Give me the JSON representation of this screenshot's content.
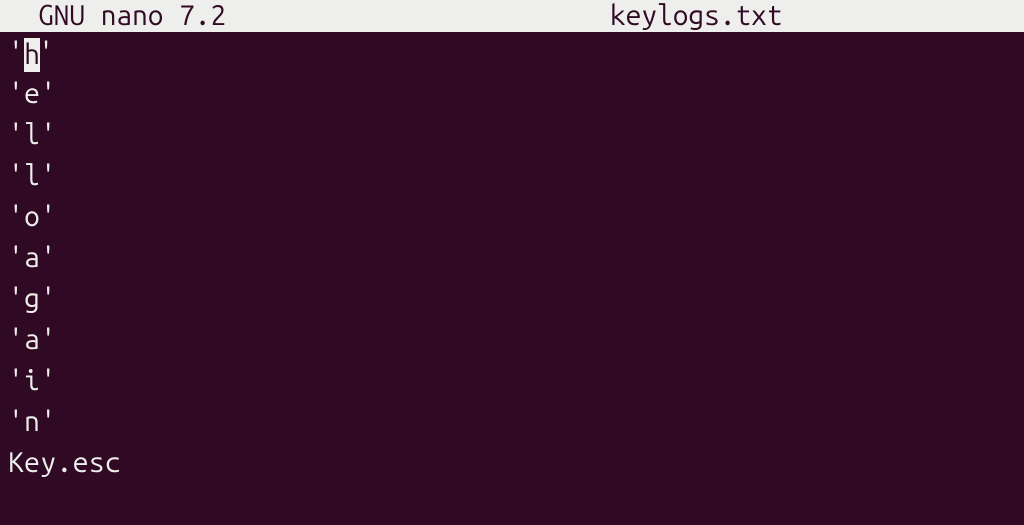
{
  "titlebar": {
    "app": "GNU nano 7.2",
    "filename": "keylogs.txt"
  },
  "editor": {
    "lines": [
      "'h'",
      "'e'",
      "'l'",
      "'l'",
      "'o'",
      "'a'",
      "'g'",
      "'a'",
      "'i'",
      "'n'",
      "Key.esc"
    ],
    "cursor": {
      "row": 0,
      "col": 1
    }
  }
}
